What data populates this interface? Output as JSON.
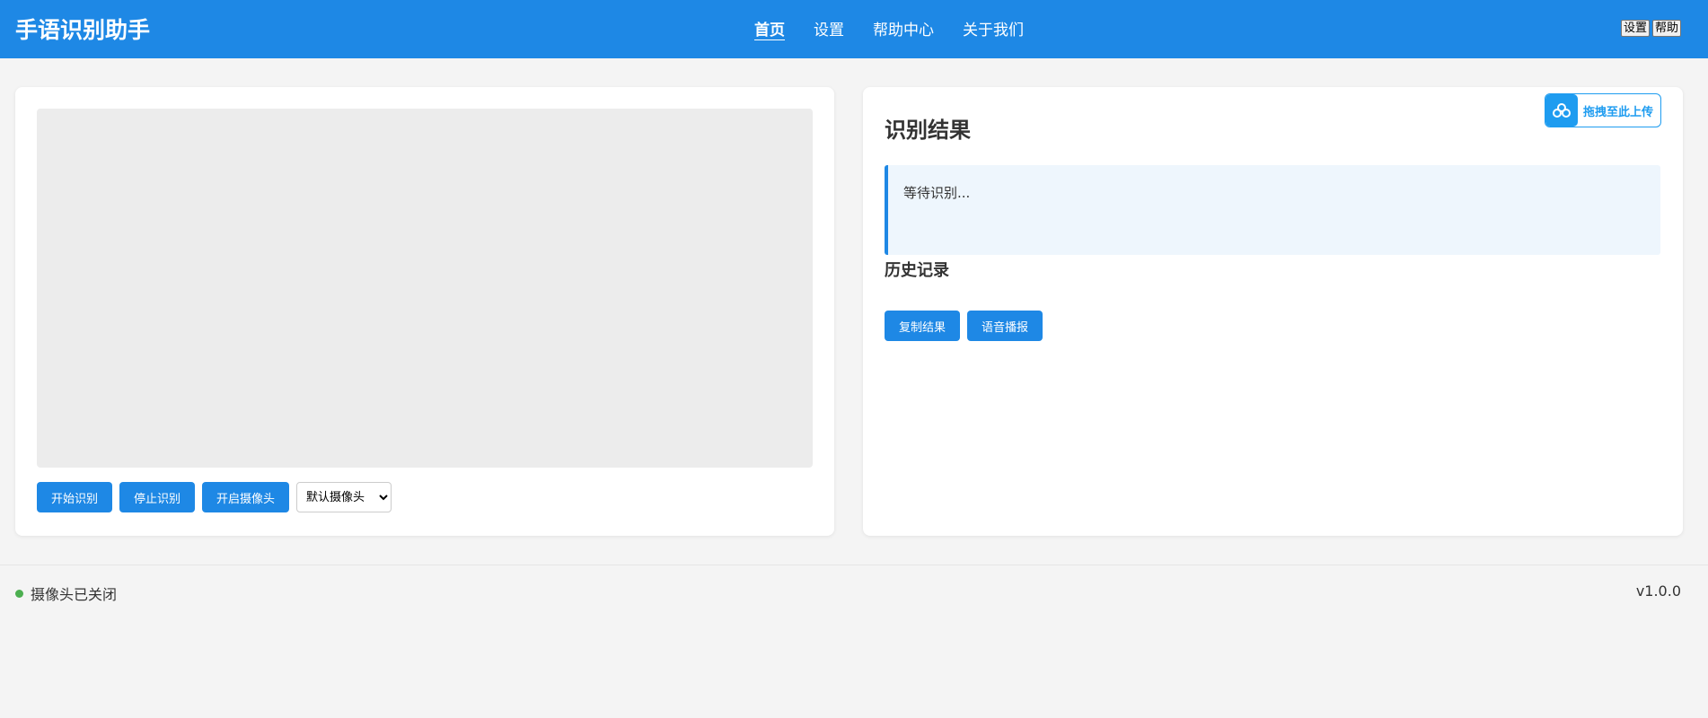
{
  "app": {
    "title": "手语识别助手"
  },
  "nav": {
    "items": [
      {
        "label": "首页",
        "active": true
      },
      {
        "label": "设置",
        "active": false
      },
      {
        "label": "帮助中心",
        "active": false
      },
      {
        "label": "关于我们",
        "active": false
      }
    ]
  },
  "header_buttons": {
    "settings": "设置",
    "help": "帮助"
  },
  "camera_panel": {
    "buttons": {
      "start": "开始识别",
      "stop": "停止识别",
      "open_camera": "开启摄像头"
    },
    "camera_select": {
      "selected": "默认摄像头"
    }
  },
  "result_panel": {
    "upload_badge": "拖拽至此上传",
    "title": "识别结果",
    "result_text": "等待识别...",
    "history_title": "历史记录",
    "buttons": {
      "copy": "复制结果",
      "speak": "语音播报"
    }
  },
  "footer": {
    "status": "摄像头已关闭",
    "version": "v1.0.0"
  },
  "colors": {
    "primary": "#1e88e5",
    "status_dot": "#4caf50",
    "upload_accent": "#1e9cf0"
  }
}
